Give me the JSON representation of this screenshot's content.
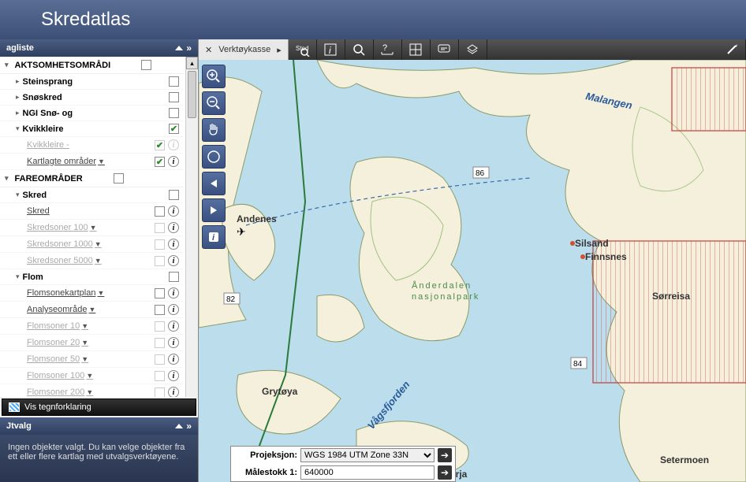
{
  "header": {
    "title": "Skredatlas"
  },
  "panels": {
    "lagliste_title": "agliste",
    "utvalg_title": "Jtvalg",
    "utvalg_body": "Ingen objekter valgt. Du kan velge objekter fra ett eller flere kartlag med utvalgsverktøyene."
  },
  "legend_btn": "Vis tegnforklaring",
  "layers": {
    "group1": "AKTSOMHETSOMRÅDI",
    "steinsprang": "Steinsprang",
    "snoskred": "Snøskred",
    "ngi": "NGI Snø- og",
    "kvikkleire": "Kvikkleire",
    "kvikkleire_sub": "Kvikkleire -",
    "kartlagte": "Kartlagte områder",
    "group2": "FAREOMRÅDER",
    "skred_grp": "Skred",
    "skred": "Skred",
    "skredsoner100": "Skredsoner 100",
    "skredsoner1000": "Skredsoner 1000",
    "skredsoner5000": "Skredsoner 5000",
    "flom_grp": "Flom",
    "flomsonekartplan": "Flomsonekartplan",
    "analyseomrade": "Analyseområde",
    "flomsoner10": "Flomsoner 10",
    "flomsoner20": "Flomsoner 20",
    "flomsoner50": "Flomsoner 50",
    "flomsoner100": "Flomsoner 100",
    "flomsoner200": "Flomsoner 200"
  },
  "toolbar": {
    "verktoykasse": "Verktøykasse"
  },
  "map": {
    "places": {
      "andenes": "Andenes",
      "grytoya": "Grytøya",
      "andorja": "Andørja",
      "silsand": "Silsand",
      "finnsnes": "Finnsnes",
      "sorreisa": "Sørreisa",
      "setermoen": "Setermoen"
    },
    "water": {
      "malangen": "Malangen",
      "vagsfjorden": "Vågsfjorden"
    },
    "park": {
      "anderdalen1": "Ånderdalen",
      "anderdalen2": "nasjonalpark"
    },
    "roads": {
      "r86": "86",
      "r84": "84",
      "r82": "82"
    }
  },
  "bottom": {
    "projeksjon_label": "Projeksjon:",
    "projeksjon_value": "WGS 1984 UTM Zone 33N",
    "malestokk_label": "Målestokk 1:",
    "malestokk_value": "640000"
  }
}
